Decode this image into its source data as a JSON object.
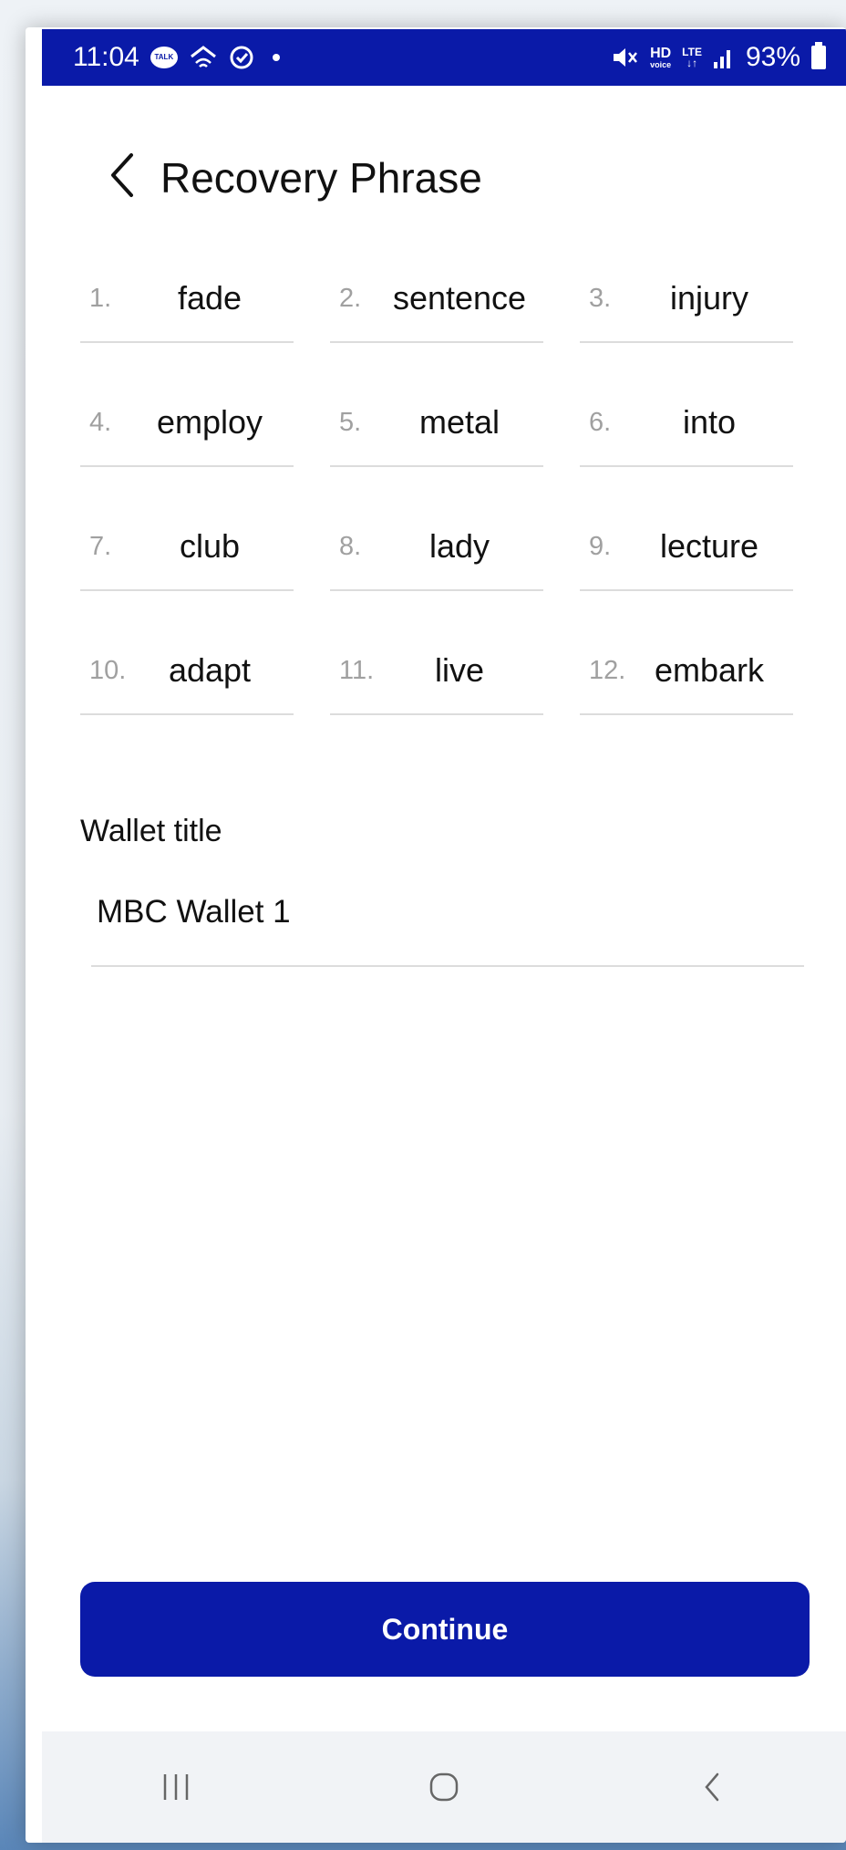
{
  "status_bar": {
    "time": "11:04",
    "talk_label": "TALK",
    "hd_top": "HD",
    "hd_bottom": "voice",
    "lte_top": "LTE",
    "lte_bottom": "↓↑",
    "battery": "93%",
    "icons": [
      "talk-icon",
      "home-wifi-icon",
      "location-icon",
      "dot-icon",
      "mute-icon",
      "hd-voice-icon",
      "lte-icon",
      "signal-icon",
      "battery-icon"
    ]
  },
  "header": {
    "title": "Recovery Phrase",
    "back_icon": "chevron-left-icon"
  },
  "phrase": [
    {
      "index": "1.",
      "word": "fade"
    },
    {
      "index": "2.",
      "word": "sentence"
    },
    {
      "index": "3.",
      "word": "injury"
    },
    {
      "index": "4.",
      "word": "employ"
    },
    {
      "index": "5.",
      "word": "metal"
    },
    {
      "index": "6.",
      "word": "into"
    },
    {
      "index": "7.",
      "word": "club"
    },
    {
      "index": "8.",
      "word": "lady"
    },
    {
      "index": "9.",
      "word": "lecture"
    },
    {
      "index": "10.",
      "word": "adapt"
    },
    {
      "index": "11.",
      "word": "live"
    },
    {
      "index": "12.",
      "word": "embark"
    }
  ],
  "wallet": {
    "label": "Wallet title",
    "value": "MBC Wallet 1"
  },
  "continue_label": "Continue",
  "colors": {
    "brand": "#0a1aa8",
    "divider": "#dcdcdc",
    "index_gray": "#a0a0a0"
  },
  "nav_icons": [
    "recent-apps-icon",
    "home-icon",
    "back-icon"
  ]
}
